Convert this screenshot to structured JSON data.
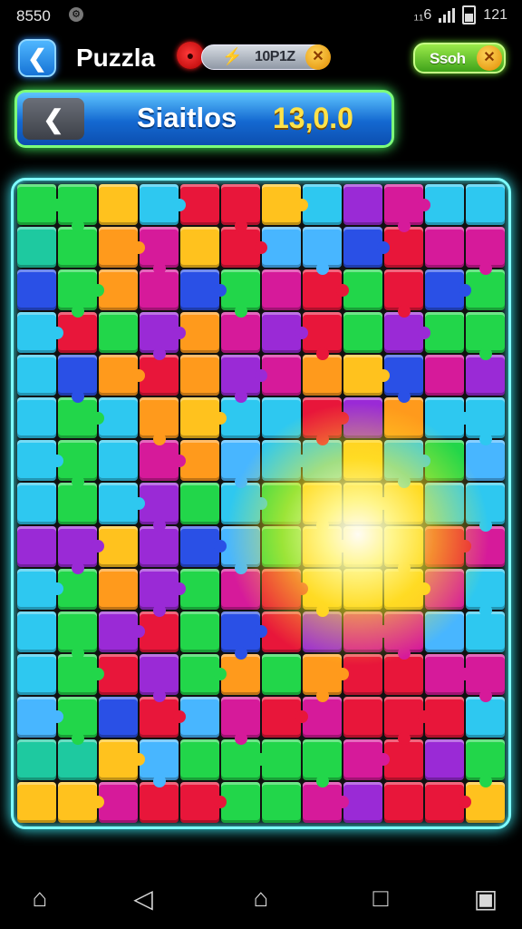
{
  "status_bar": {
    "time": "8550",
    "notification_icon": "gear-badge-icon",
    "network": "₁₁6",
    "clock": "121"
  },
  "header": {
    "back_icon": "chevron-left-icon",
    "title": "Puzzla",
    "mascot_icon": "red-monster-icon",
    "bolt_icon": "lightning-icon",
    "score_value": "10P1Z",
    "coin_icon": "coin-icon",
    "shop_label": "Ssoh"
  },
  "banner": {
    "back_icon": "chevron-left-icon",
    "label": "Siaitlos",
    "value": "13,0.0"
  },
  "board": {
    "rows": 15,
    "cols": 12,
    "palette": {
      "C": "#2ec8f0",
      "G": "#22d64a",
      "Y": "#ffc21e",
      "O": "#ff9a1c",
      "R": "#e8163a",
      "M": "#d61a9a",
      "P": "#9a2ad6",
      "B": "#2a50e6",
      "L": "#48b6ff",
      "T": "#1ec9a0"
    },
    "layout": [
      "GGYCRRYCPMCC",
      "TGOMYRLLBRMM",
      "BGOMBGMRGRBG",
      "CRGPOMPRGPGG",
      "CBOROPMOYBMP",
      "CGCOYCCRPOCC",
      "CGCMOLCCYCGL",
      "CGCPGCGYYYCC",
      "PPYPBLGYYYRM",
      "CGOPGMRYYYMC",
      "CGPRGBRPMMLC",
      "CGRPGOGORRMM",
      "LGBRLMRMRRRC",
      "TTYLGGGGMRPG",
      "YYMRRGGMPRRY"
    ],
    "highlight": "glowing-burst"
  },
  "nav": {
    "home_icon": "home-icon",
    "back_icon": "triangle-back-icon",
    "home2_icon": "house-outline-icon",
    "recent_icon": "square-recent-icon",
    "screenshot_icon": "camera-icon"
  }
}
